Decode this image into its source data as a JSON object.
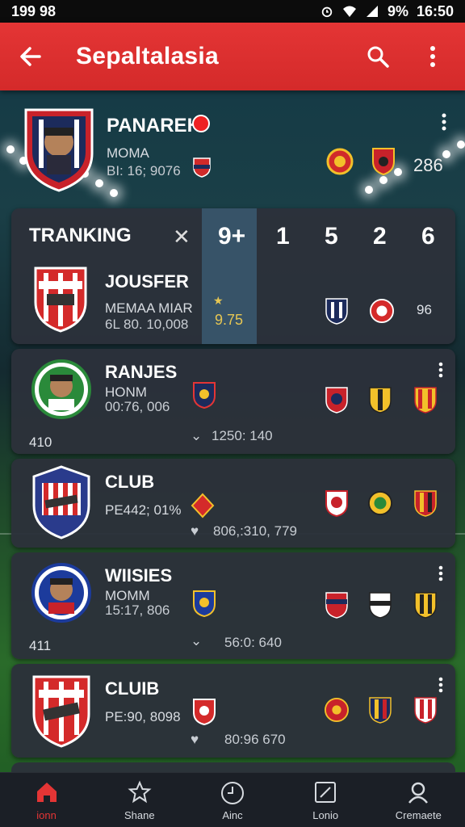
{
  "status_bar": {
    "time_left": "199 98",
    "battery": "9%",
    "time_right": "16:50"
  },
  "app_bar": {
    "title": "Sepaltalasia"
  },
  "hero": {
    "name": "PANAREH",
    "sub": "MOMA",
    "stats": "BI: 16; 9076",
    "count": "286"
  },
  "tracking": {
    "label": "TRANKING",
    "columns": [
      "9+",
      "1",
      "5",
      "2",
      "6"
    ],
    "row": {
      "title": "JOUSFER",
      "sub": "MEMAA MIAR",
      "stats": "6L 80. 10,008",
      "score": "9.75",
      "count": "96"
    }
  },
  "cards": [
    {
      "title": "RANJES",
      "sub": "HONM",
      "stats": "00:76, 006",
      "rank": "410",
      "meta": "1250: 140"
    },
    {
      "title": "CLUB",
      "sub": "PE442; 01%",
      "meta": "806,:310, 779"
    },
    {
      "title": "WIISIES",
      "sub": "MOMM",
      "stats": "15:17, 806",
      "rank": "411",
      "meta": "56:0: 640"
    },
    {
      "title": "CLUIB",
      "sub": "PE:90, 8098",
      "meta": "80:96 670"
    }
  ],
  "nav": [
    {
      "label": "ionn",
      "icon": "home-icon"
    },
    {
      "label": "Shane",
      "icon": "star-icon"
    },
    {
      "label": "Ainc",
      "icon": "clock-icon"
    },
    {
      "label": "Lonio",
      "icon": "edit-icon"
    },
    {
      "label": "Cremaete",
      "icon": "profile-icon"
    }
  ],
  "colors": {
    "accent": "#e43535",
    "card": "#2c313a",
    "gold": "#e6c653"
  }
}
